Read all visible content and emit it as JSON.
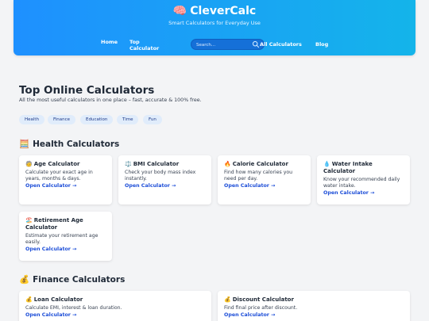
{
  "header": {
    "brand": "CleverCalc",
    "brand_icon": "🧠",
    "tagline": "Smart Calculators for Everyday Use",
    "nav": {
      "home": "Home",
      "top_1": "Top",
      "top_2": "Calculator",
      "all": "All Calculators",
      "blog": "Blog"
    },
    "search_placeholder": "Search..."
  },
  "intro": {
    "title": "Top Online Calculators",
    "subtitle": "All the most useful calculators in one place – fast, accurate & 100% free."
  },
  "tags": [
    "Health",
    "Finance",
    "Education",
    "Time",
    "Fun"
  ],
  "sections": {
    "health": {
      "emoji": "🧮",
      "title": "Health Calculators"
    },
    "finance": {
      "emoji": "💰",
      "title": "Finance Calculators"
    }
  },
  "cards": {
    "age": {
      "emoji": "🧓",
      "title": "Age Calculator",
      "desc": "Calculate your exact age in years, months & days.",
      "link": "Open Calculator →"
    },
    "bmi": {
      "emoji": "⚖️",
      "title": "BMI Calculator",
      "desc": "Check your body mass index instantly.",
      "link": "Open Calculator →"
    },
    "calorie": {
      "emoji": "🔥",
      "title": "Calorie Calculator",
      "desc": "Find how many calories you need per day.",
      "link": "Open Calculator →"
    },
    "water": {
      "emoji": "💧",
      "title": "Water Intake Calculator",
      "desc": "Know your recommended daily water intake.",
      "link": "Open Calculator →"
    },
    "retirement": {
      "emoji": "🏖️",
      "title": "Retirement Age Calculator",
      "desc": "Estimate your retirement age easily.",
      "link": "Open Calculator →"
    },
    "loan": {
      "emoji": "💰",
      "title": "Loan Calculator",
      "desc": "Calculate EMI, interest & loan duration.",
      "link": "Open Calculator →"
    },
    "discount": {
      "emoji": "💰",
      "title": "Discount Calculator",
      "desc": "Find final price after discount.",
      "link": "Open Calculator →"
    }
  },
  "colors": {
    "header_start": "#1e90ff",
    "header_end": "#14b4ea",
    "link": "#1d4ed8",
    "tag_bg": "#e0ecfb",
    "page_bg": "#f3f4f6"
  }
}
